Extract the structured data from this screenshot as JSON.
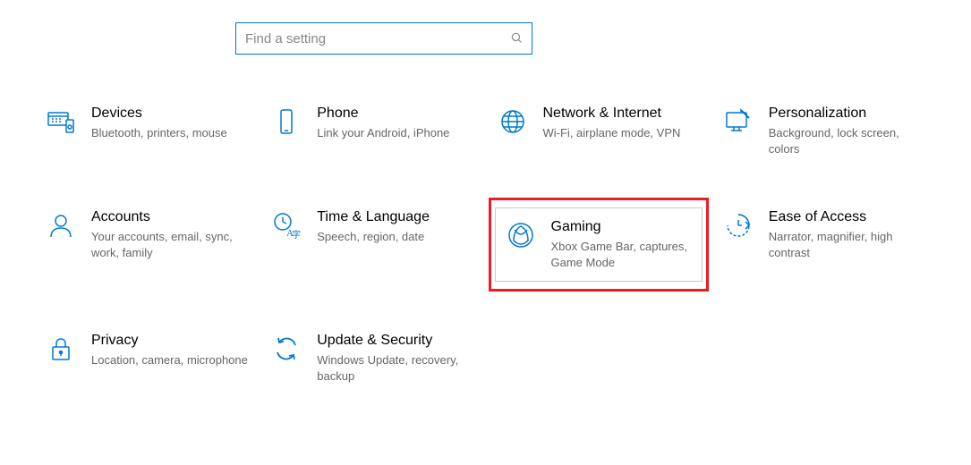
{
  "search": {
    "placeholder": "Find a setting"
  },
  "categories": [
    {
      "id": "devices",
      "title": "Devices",
      "desc": "Bluetooth, printers, mouse",
      "icon": "devices-icon"
    },
    {
      "id": "phone",
      "title": "Phone",
      "desc": "Link your Android, iPhone",
      "icon": "phone-icon"
    },
    {
      "id": "network",
      "title": "Network & Internet",
      "desc": "Wi-Fi, airplane mode, VPN",
      "icon": "globe-icon"
    },
    {
      "id": "personalization",
      "title": "Personalization",
      "desc": "Background, lock screen, colors",
      "icon": "personalization-icon"
    },
    {
      "id": "accounts",
      "title": "Accounts",
      "desc": "Your accounts, email, sync, work, family",
      "icon": "accounts-icon"
    },
    {
      "id": "time-language",
      "title": "Time & Language",
      "desc": "Speech, region, date",
      "icon": "time-language-icon"
    },
    {
      "id": "gaming",
      "title": "Gaming",
      "desc": "Xbox Game Bar, captures, Game Mode",
      "icon": "gaming-icon",
      "highlighted": true
    },
    {
      "id": "ease-of-access",
      "title": "Ease of Access",
      "desc": "Narrator, magnifier, high contrast",
      "icon": "ease-of-access-icon"
    },
    {
      "id": "privacy",
      "title": "Privacy",
      "desc": "Location, camera, microphone",
      "icon": "privacy-icon"
    },
    {
      "id": "update-security",
      "title": "Update & Security",
      "desc": "Windows Update, recovery, backup",
      "icon": "update-security-icon"
    }
  ],
  "accent_color": "#0078d4",
  "highlight_color": "#ec1c24"
}
